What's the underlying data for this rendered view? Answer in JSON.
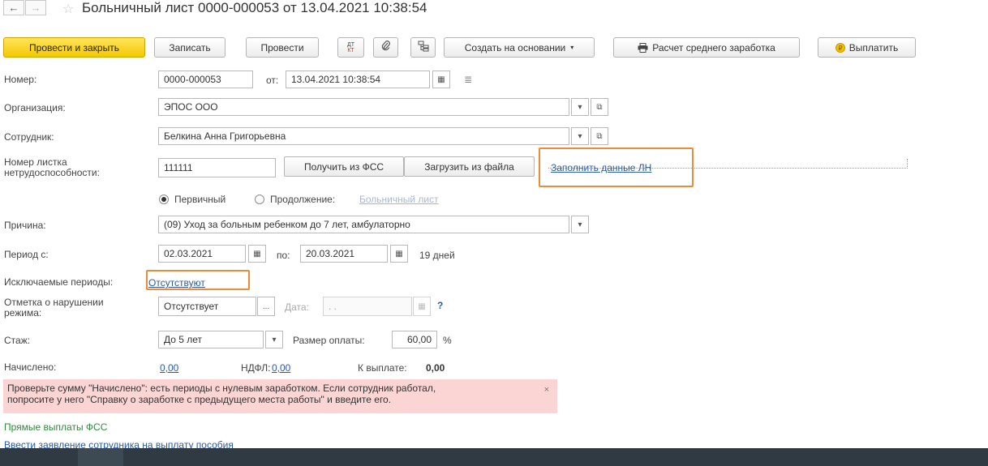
{
  "nav": {
    "back": "←",
    "forward": "→"
  },
  "title": "Больничный лист 0000-000053 от 13.04.2021 10:38:54",
  "toolbar": {
    "post_close": "Провести и закрыть",
    "save": "Записать",
    "post": "Провести",
    "dtkt_top": "ДТ",
    "dtkt_bottom": "КТ",
    "create_based": "Создать на основании",
    "avg_earnings": "Расчет среднего заработка",
    "pay": "Выплатить"
  },
  "form": {
    "number_label": "Номер:",
    "number_value": "0000-000053",
    "from_label": "от:",
    "date_value": "13.04.2021 10:38:54",
    "org_label": "Организация:",
    "org_value": "ЭПОС ООО",
    "employee_label": "Сотрудник:",
    "employee_value": "Белкина Анна Григорьевна",
    "sheet_label_1": "Номер листка",
    "sheet_label_2": "нетрудоспособности:",
    "sheet_value": "111111",
    "get_fss": "Получить из ФСС",
    "load_file": "Загрузить из файла",
    "fill_ln": "Заполнить данные ЛН",
    "primary": "Первичный",
    "continuation": "Продолжение:",
    "sick_link": "Больничный лист",
    "reason_label": "Причина:",
    "reason_value": "(09) Уход за больным ребенком до 7 лет, амбулаторно",
    "period_label": "Период с:",
    "period_from": "02.03.2021",
    "period_to_label": "по:",
    "period_to": "20.03.2021",
    "days": "19 дней",
    "excluded_label": "Исключаемые периоды:",
    "excluded_value": "Отсутствуют",
    "violation_label_1": "Отметка о нарушении",
    "violation_label_2": "режима:",
    "violation_value": "Отсутствует",
    "violation_dots": "...",
    "date_label": "Дата:",
    "date_placeholder": " .  .",
    "help": "?",
    "stazh_label": "Стаж:",
    "stazh_value": "До 5 лет",
    "pay_size_label": "Размер оплаты:",
    "pay_size_value": "60,00",
    "percent": "%",
    "accrued_label": "Начислено:",
    "accrued_value": "0,00",
    "ndfl_label": "НДФЛ:",
    "ndfl_value": "0,00",
    "to_pay_label": "К выплате:",
    "to_pay_value": "0,00"
  },
  "warning": {
    "line1": "Проверьте сумму \"Начислено\": есть периоды с нулевым заработком. Если сотрудник работал,",
    "line2": "попросите у него \"Справку о заработке с предыдущего места работы\" и введите его.",
    "close": "×"
  },
  "links": {
    "direct_fss": "Прямые выплаты ФСС",
    "employee_application": "Ввести заявление сотрудника на выплату пособия"
  },
  "colors": {
    "primary_button": "#f4c900",
    "highlight": "#ee8a3a",
    "warning_bg": "#fbd4d4",
    "link": "#2a5aa8",
    "green_link": "#2e8b3a"
  }
}
